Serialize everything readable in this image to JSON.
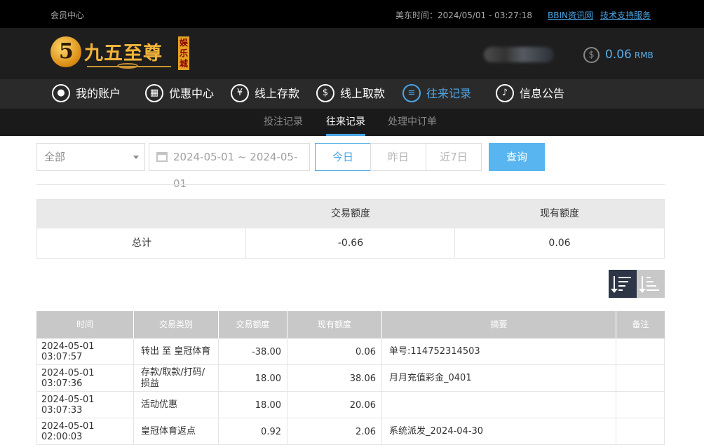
{
  "topbar": {
    "member_center": "会员中心",
    "time_label": "美东时间：2024/05/01 - 03:27:18",
    "link_bbin": "BBIN资讯网",
    "link_support": "技术支持服务"
  },
  "header": {
    "logo_text": "九五至尊",
    "logo_number": "5",
    "logo_tag": "娱乐城",
    "balance": "0.06",
    "currency": "RMB"
  },
  "nav": {
    "items": [
      {
        "label": "我的账户",
        "icon": "user-icon"
      },
      {
        "label": "优惠中心",
        "icon": "gift-icon"
      },
      {
        "label": "线上存款",
        "icon": "deposit-icon"
      },
      {
        "label": "线上取款",
        "icon": "withdraw-icon"
      },
      {
        "label": "往来记录",
        "icon": "records-icon"
      },
      {
        "label": "信息公告",
        "icon": "bell-icon"
      }
    ],
    "active": "往来记录"
  },
  "subnav": {
    "items": [
      "投注记录",
      "往来记录",
      "处理中订单"
    ],
    "active": "往来记录"
  },
  "filter": {
    "type_value": "全部",
    "date_range": "2024-05-01 ~ 2024-05-01",
    "today": "今日",
    "yesterday": "昨日",
    "last7": "近7日",
    "query": "查询"
  },
  "summary": {
    "col_amount": "交易额度",
    "col_balance": "现有额度",
    "row_label": "总计",
    "amount": "-0.66",
    "balance": "0.06"
  },
  "table": {
    "headers": [
      "时间",
      "交易类别",
      "交易额度",
      "现有额度",
      "摘要",
      "备注"
    ],
    "rows": [
      {
        "time": "2024-05-01 03:07:57",
        "type": "转出 至 皇冠体育",
        "amount": "-38.00",
        "balance": "0.06",
        "summary": "单号:114752314503",
        "note": ""
      },
      {
        "time": "2024-05-01 03:07:36",
        "type": "存款/取款/打码/损益",
        "amount": "18.00",
        "balance": "38.06",
        "summary": "月月充值彩金_0401",
        "note": ""
      },
      {
        "time": "2024-05-01 03:07:33",
        "type": "活动优惠",
        "amount": "18.00",
        "balance": "20.06",
        "summary": "",
        "note": ""
      },
      {
        "time": "2024-05-01 02:00:03",
        "type": "皇冠体育返点",
        "amount": "0.92",
        "balance": "2.06",
        "summary": "系统派发_2024-04-30",
        "note": ""
      }
    ]
  },
  "colors": {
    "accent": "#4aa6e6",
    "query_button": "#59b5f0",
    "header_bg": "#1e1e1e",
    "table_header": "#c8c8c8"
  }
}
